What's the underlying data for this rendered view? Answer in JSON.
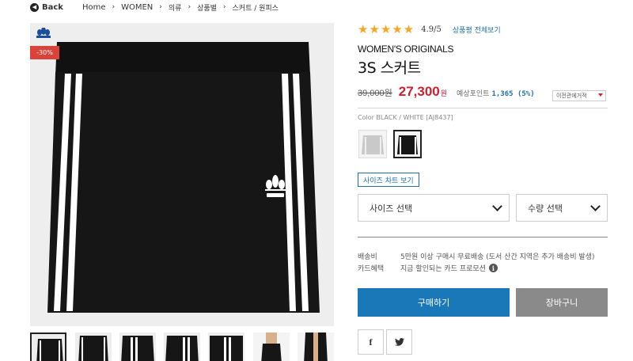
{
  "breadcrumb": {
    "back_label": "Back",
    "items": [
      "Home",
      "WOMEN",
      "의류",
      "상품별",
      "스커트 / 원피스"
    ]
  },
  "product_image": {
    "discount_badge": "-30%"
  },
  "rating": {
    "stars": "★★★★★",
    "score": "4.9/5",
    "review_link": "상품평 전체보기"
  },
  "product": {
    "category": "WOMEN'S ORIGINALS",
    "name": "3S 스커트",
    "original_price": "39,000원",
    "sale_price": "27,300",
    "currency": "원",
    "points_label": "예상포인트",
    "points_value": "1,365 (5%)",
    "card_select": "이전관에거적",
    "color_info": "Color BLACK / WHITE [AJ8437]"
  },
  "options": {
    "size_chart_label": "사이즈 차트 보기",
    "size_select": "사이즈 선택",
    "qty_select": "수량 선택"
  },
  "shipping": {
    "delivery_label": "배송비",
    "delivery_value": "5만원 이상 구매시 무료배송 (도서 산간 지역은 추가 배송비 발생)",
    "card_label": "카드혜택",
    "card_value": "지금 할인되는 카드 프로모션"
  },
  "actions": {
    "buy_label": "구매하기",
    "cart_label": "장바구니"
  },
  "share": {
    "facebook": "f",
    "twitter": "🐦"
  },
  "colors": {
    "accent_blue": "#1a78b9",
    "sale_red": "#c8202f",
    "badge_red": "#d9433a",
    "star_gold": "#f5a623",
    "cart_grey": "#8a8a8a"
  }
}
